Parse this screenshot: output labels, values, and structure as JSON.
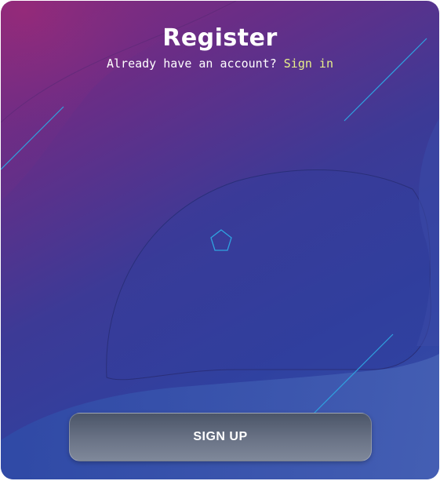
{
  "register": {
    "title": "Register",
    "prompt": "Already have an account?",
    "signin_label": "Sign in",
    "signup_label": "SIGN UP"
  },
  "colors": {
    "link": "#e8f08a",
    "line_accent": "#2fa3e0",
    "bg_top_left": "#8a2a7c",
    "bg_bottom_right": "#3a52ad"
  }
}
